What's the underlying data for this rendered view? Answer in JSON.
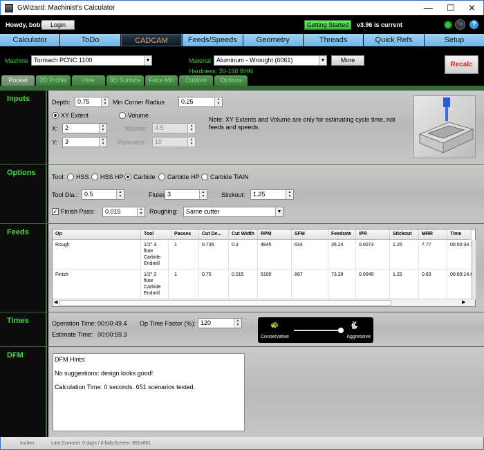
{
  "window": {
    "title": "GWizard: Machinist's Calculator",
    "minimize": "—",
    "maximize": "☐",
    "close": "✕"
  },
  "header": {
    "greeting": "Howdy, bob!",
    "login": "Login",
    "getting_started": "Getting Started",
    "version": "v3.96 is current",
    "tip": "Tip",
    "help": "?"
  },
  "nav": [
    "Calculator",
    "ToDo",
    "CADCAM",
    "Feeds/Speeds",
    "Geometry",
    "Threads",
    "Quick Refs",
    "Setup"
  ],
  "machine": {
    "label": "Machine",
    "value": "Tormach PCNC 1100"
  },
  "material": {
    "label": "Material",
    "value": "Aluminum - Wrought (6061)",
    "more": "More",
    "hardness": "Hardness: 20-150 BHN"
  },
  "recalc": "Recalc",
  "subtabs": [
    "Pocket",
    "2D Profile",
    "Hole",
    "3D Surface",
    "Face Mill",
    "Custom",
    "Options"
  ],
  "inputs": {
    "title": "Inputs",
    "depth_label": "Depth:",
    "depth": "0.75",
    "mcr_label": "Min Corner Radius",
    "mcr": "0.25",
    "xy_label": "XY Extent",
    "vol_label": "Volume",
    "x_label": "X:",
    "x": "2",
    "y_label": "Y:",
    "y": "3",
    "volume_label": "Volume:",
    "volume": "4.5",
    "perimeter_label": "Perimeter:",
    "perimeter": "10",
    "note": "Note: XY Extents and Volume are only for estimating cycle time, not feeds and speeds."
  },
  "options": {
    "title": "Options",
    "tool_label": "Tool:",
    "tools": [
      "HSS",
      "HSS HP",
      "Carbide",
      "Carbide HP",
      "Carbide TiAlN"
    ],
    "selected_tool": "Carbide",
    "dia_label": "Tool Dia.:",
    "dia": "0.5",
    "flutes_label": "Flutes:",
    "flutes": "3",
    "stickout_label": "Stickout:",
    "stickout": "1.25",
    "finish_label": "Finish Pass:",
    "finish": "0.015",
    "finish_checked": true,
    "roughing_label": "Roughing:",
    "roughing": "Same cutter"
  },
  "feeds": {
    "title": "Feeds",
    "columns": [
      "Op",
      "Tool",
      "Passes",
      "Cut De...",
      "Cut Width",
      "RPM",
      "SFM",
      "Feedrate",
      "IPR",
      "Stickout",
      "MRR",
      "Time"
    ],
    "rows": [
      [
        "Rough",
        "1/2\" 3 flute Carbide Endmill",
        "1",
        "0.735",
        "0.3",
        "4845",
        "634",
        "35.24",
        "0.0073",
        "1.25",
        "7.77",
        "00:00:34.7"
      ],
      [
        "Finish",
        "1/2\" 3 flute Carbide Endmill",
        "1",
        "0.75",
        "0.015",
        "5100",
        "667",
        "73.39",
        "0.0049",
        "1.25",
        "0.83",
        "00:00:14.6"
      ]
    ]
  },
  "times": {
    "title": "Times",
    "op_label": "Operation Time:",
    "op": "00:00:49.4",
    "est_label": "Estimate Time:",
    "est": "00:00:59.3",
    "factor_label": "Op Time Factor (%):",
    "factor": "120",
    "conservative": "Conservative",
    "aggressive": "Aggressive",
    "slider_value": 1.0
  },
  "dfm": {
    "title": "DFM",
    "line1": "DFM Hints:",
    "line2": "No suggestions: design looks good!",
    "line3": "Calculation Time: 0 seconds. 651 scenarios tested."
  },
  "status": {
    "units": "Inches",
    "connect": "Last Connect: 0 days / 0 fails",
    "screen": "Screen: 991x891"
  }
}
